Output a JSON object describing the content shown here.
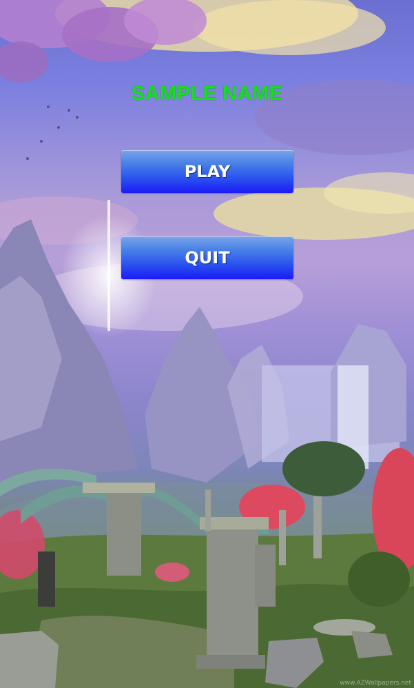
{
  "game": {
    "title": "SAMPLE NAME",
    "menu": {
      "play_label": "PLAY",
      "quit_label": "QUIT"
    },
    "watermark": "www.AZWallpapers.net"
  },
  "colors": {
    "title": "#15e11a",
    "button_top": "#7aa5ea",
    "button_bottom": "#1b1bf6",
    "button_text": "#ffffff"
  }
}
